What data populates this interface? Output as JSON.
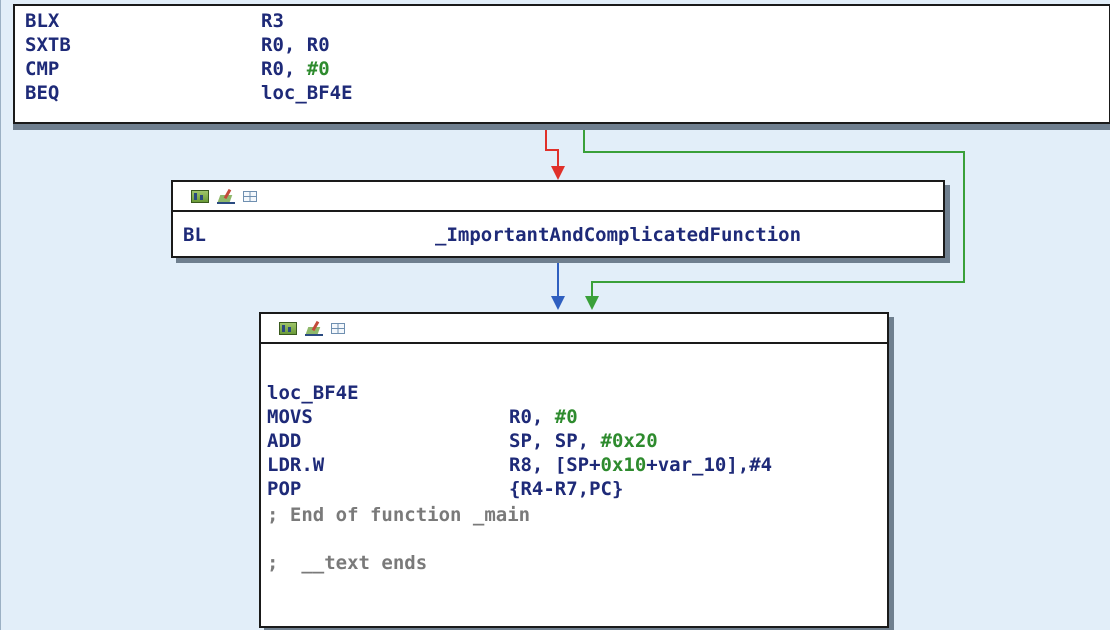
{
  "top_block": {
    "rows": [
      {
        "mnemonic": "BLX",
        "operand": "R3"
      },
      {
        "mnemonic": "SXTB",
        "operand": "R0, R0"
      },
      {
        "mnemonic": "CMP",
        "operand_pre": "R0, ",
        "operand_num": "#0"
      },
      {
        "mnemonic": "BEQ",
        "operand": "loc_BF4E"
      }
    ]
  },
  "middle_block": {
    "mnemonic": "BL",
    "operand": "_ImportantAndComplicatedFunction"
  },
  "bottom_block": {
    "label": "loc_BF4E",
    "rows": [
      {
        "mnemonic": "MOVS",
        "pre": "R0, ",
        "num": "#0",
        "post": ""
      },
      {
        "mnemonic": "ADD",
        "pre": "SP, SP, ",
        "num": "#0x20",
        "post": ""
      },
      {
        "mnemonic": "LDR.W",
        "pre": "R8, [SP+",
        "num": "0x10",
        "mid": "+var_10],",
        "num2": "#4"
      },
      {
        "mnemonic": "POP",
        "pre": "{R4-R7,PC}",
        "num": "",
        "post": ""
      }
    ],
    "comment1": "; End of function _main",
    "comment2": ";  __text ends"
  },
  "icons": {
    "graph": "graph-overview-icon",
    "edit": "edit-node-icon",
    "grid": "node-grid-icon"
  },
  "colors": {
    "edge_false": "#e0302a",
    "edge_true": "#3aa03a",
    "edge_uncond": "#2f5fc0",
    "canvas": "#e2eef9",
    "number": "#2e8b2e",
    "mnemonic": "#1e2a78"
  }
}
